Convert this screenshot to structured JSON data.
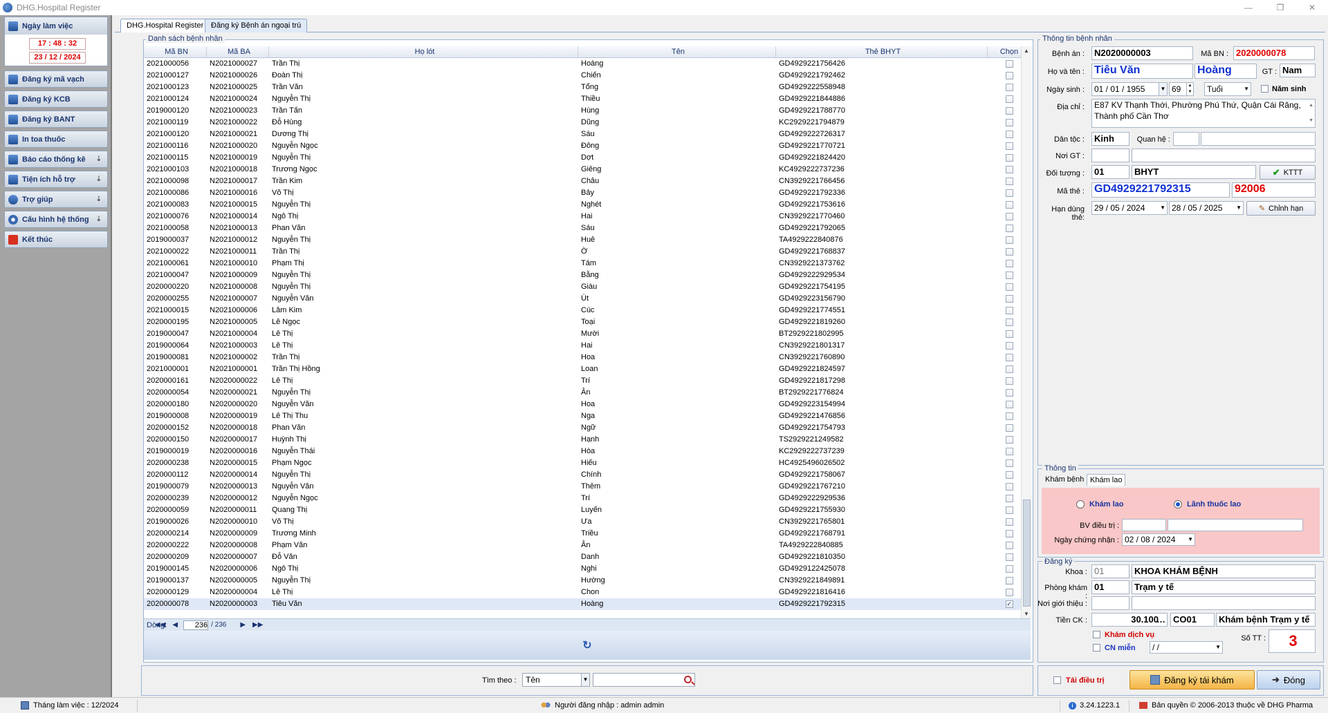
{
  "window": {
    "title": "DHG.Hospital Register"
  },
  "sidebar": {
    "clock_title": "Ngày làm việc",
    "time": "17 : 48 : 32",
    "date": "23 / 12 / 2024",
    "items": [
      {
        "label": "Đăng ký mã vạch",
        "icon": "barcode-icon",
        "chevron": false
      },
      {
        "label": "Đăng ký KCB",
        "icon": "clipboard-icon",
        "chevron": false
      },
      {
        "label": "Đăng ký BANT",
        "icon": "record-icon",
        "chevron": false
      },
      {
        "label": "In toa thuốc",
        "icon": "printer-icon",
        "chevron": false
      },
      {
        "label": "Báo cáo thống kê",
        "icon": "report-icon",
        "chevron": true
      },
      {
        "label": "Tiện ích hỗ trợ",
        "icon": "tools-icon",
        "chevron": true
      },
      {
        "label": "Trợ giúp",
        "icon": "help-icon",
        "chevron": true
      },
      {
        "label": "Cấu hình hệ thống",
        "icon": "gear-icon",
        "chevron": true
      },
      {
        "label": "Kết thúc",
        "icon": "exit-icon",
        "chevron": false
      }
    ]
  },
  "tabs": [
    {
      "label": "DHG.Hospital Register"
    },
    {
      "label": "Đăng ký Bệnh án ngoại trú"
    }
  ],
  "list": {
    "group_title": "Danh sách bệnh nhân",
    "columns": [
      "Mã BN",
      "Mã BA",
      "Họ lót",
      "Tên",
      "Thẻ BHYT",
      "Chọn"
    ],
    "rows": [
      [
        "2021000056",
        "N2021000027",
        "Trần Thị",
        "Hoàng",
        "GD4929221756426",
        false
      ],
      [
        "2021000127",
        "N2021000026",
        "Đoàn Thị",
        "Chiến",
        "GD4929221792462",
        false
      ],
      [
        "2021000123",
        "N2021000025",
        "Trần Văn",
        "Tổng",
        "GD4929222558948",
        false
      ],
      [
        "2021000124",
        "N2021000024",
        "Nguyễn Thị",
        "Thiều",
        "GD4929221844886",
        false
      ],
      [
        "2019000120",
        "N2021000023",
        "Trần Tấn",
        "Hùng",
        "GD4929221788770",
        false
      ],
      [
        "2021000119",
        "N2021000022",
        "Đỗ Hùng",
        "Dũng",
        "KC2929221794879",
        false
      ],
      [
        "2021000120",
        "N2021000021",
        "Dương Thị",
        "Sáu",
        "GD4929222726317",
        false
      ],
      [
        "2021000116",
        "N2021000020",
        "Nguyễn Ngọc",
        "Đông",
        "GD4929221770721",
        false
      ],
      [
        "2021000115",
        "N2021000019",
        "Nguyễn Thị",
        "Dợt",
        "GD4929221824420",
        false
      ],
      [
        "2021000103",
        "N2021000018",
        "Trương Ngọc",
        "Giêng",
        "KC4929222737236",
        false
      ],
      [
        "2021000098",
        "N2021000017",
        "Trần Kim",
        "Châu",
        "CN3929221766456",
        false
      ],
      [
        "2021000086",
        "N2021000016",
        "Võ Thị",
        "Bảy",
        "GD4929221792336",
        false
      ],
      [
        "2021000083",
        "N2021000015",
        "Nguyễn Thị",
        "Nghét",
        "GD4929221753616",
        false
      ],
      [
        "2021000076",
        "N2021000014",
        "Ngô Thị",
        "Hai",
        "CN3929221770460",
        false
      ],
      [
        "2021000058",
        "N2021000013",
        "Phan Văn",
        "Sáu",
        "GD4929221792065",
        false
      ],
      [
        "2019000037",
        "N2021000012",
        "Nguyễn Thị",
        "Huê",
        "TA4929222840876",
        false
      ],
      [
        "2021000022",
        "N2021000011",
        "Trần Thị",
        "Ờ",
        "GD4929221768837",
        false
      ],
      [
        "2021000061",
        "N2021000010",
        "Phạm Thị",
        "Tám",
        "CN3929221373762",
        false
      ],
      [
        "2021000047",
        "N2021000009",
        "Nguyễn Thị",
        "Bằng",
        "GD4929222929534",
        false
      ],
      [
        "2020000220",
        "N2021000008",
        "Nguyễn Thị",
        "Giàu",
        "GD4929221754195",
        false
      ],
      [
        "2020000255",
        "N2021000007",
        "Nguyễn Văn",
        "Út",
        "GD4929223156790",
        false
      ],
      [
        "2021000015",
        "N2021000006",
        "Lâm Kim",
        "Cúc",
        "GD4929221774551",
        false
      ],
      [
        "2020000195",
        "N2021000005",
        "Lê Ngọc",
        "Toại",
        "GD4929221819260",
        false
      ],
      [
        "2019000047",
        "N2021000004",
        "Lê Thị",
        "Mười",
        "BT2929221802995",
        false
      ],
      [
        "2019000064",
        "N2021000003",
        "Lê Thị",
        "Hai",
        "CN3929221801317",
        false
      ],
      [
        "2019000081",
        "N2021000002",
        "Trần Thị",
        "Hoa",
        "CN3929221760890",
        false
      ],
      [
        "2021000001",
        "N2021000001",
        "Trần Thị Hồng",
        "Loan",
        "GD4929221824597",
        false
      ],
      [
        "2020000161",
        "N2020000022",
        "Lê Thị",
        "Trí",
        "GD4929221817298",
        false
      ],
      [
        "2020000054",
        "N2020000021",
        "Nguyễn Thị",
        "Ân",
        "BT2929221776824",
        false
      ],
      [
        "2020000180",
        "N2020000020",
        "Nguyễn Văn",
        "Hoa",
        "GD4929223154994",
        false
      ],
      [
        "2019000008",
        "N2020000019",
        "Lê Thị Thu",
        "Nga",
        "GD4929221476856",
        false
      ],
      [
        "2020000152",
        "N2020000018",
        "Phan Văn",
        "Ngữ",
        "GD4929221754793",
        false
      ],
      [
        "2020000150",
        "N2020000017",
        "Huỳnh Thị",
        "Hạnh",
        "TS2929221249582",
        false
      ],
      [
        "2019000019",
        "N2020000016",
        "Nguyễn Thái",
        "Hòa",
        "KC2929222737239",
        false
      ],
      [
        "2020000238",
        "N2020000015",
        "Phạm Ngọc",
        "Hiếu",
        "HC4925496026502",
        false
      ],
      [
        "2020000112",
        "N2020000014",
        "Nguyễn Thị",
        "Chính",
        "GD4929221758067",
        false
      ],
      [
        "2019000079",
        "N2020000013",
        "Nguyễn Văn",
        "Thêm",
        "GD4929221767210",
        false
      ],
      [
        "2020000239",
        "N2020000012",
        "Nguyễn Ngọc",
        "Trí",
        "GD4929222929536",
        false
      ],
      [
        "2020000059",
        "N2020000011",
        "Quang Thị",
        "Luyến",
        "GD4929221755930",
        false
      ],
      [
        "2019000026",
        "N2020000010",
        "Võ Thị",
        "Ưa",
        "CN3929221765801",
        false
      ],
      [
        "2020000214",
        "N2020000009",
        "Trương Minh",
        "Triều",
        "GD4929221768791",
        false
      ],
      [
        "2020000222",
        "N2020000008",
        "Phạm Văn",
        "Ân",
        "TA4929222840885",
        false
      ],
      [
        "2020000209",
        "N2020000007",
        "Đỗ Văn",
        "Danh",
        "GD4929221810350",
        false
      ],
      [
        "2019000145",
        "N2020000006",
        "Ngô Thị",
        "Nghi",
        "GD4929122425078",
        false
      ],
      [
        "2019000137",
        "N2020000005",
        "Nguyễn Thị",
        "Hường",
        "CN3929221849891",
        false
      ],
      [
        "2020000129",
        "N2020000004",
        "Lê Thị",
        "Chon",
        "GD4929221816416",
        false
      ],
      [
        "2020000078",
        "N2020000003",
        "Tiêu Văn",
        "Hoàng",
        "GD4929221792315",
        true
      ]
    ],
    "nav_label": "Dòng:",
    "current_row": "236",
    "total_rows": "/ 236"
  },
  "search": {
    "label": "Tìm theo :",
    "field_value": "Tên",
    "query": ""
  },
  "patient": {
    "group_title": "Thông tin bệnh nhân",
    "benh_an_label": "Bệnh án :",
    "benh_an": "N2020000003",
    "ma_bn_label": "Mã BN :",
    "ma_bn": "2020000078",
    "ho_ten_label": "Họ và tên :",
    "ho_lot": "Tiêu Văn",
    "ten": "Hoàng",
    "gt_label": "GT :",
    "gt": "Nam",
    "ngay_sinh_label": "Ngày sinh :",
    "ngay_sinh": "01 / 01 / 1955",
    "tuoi_num": "69",
    "tuoi_unit": "Tuổi",
    "nam_sinh_label": "Năm sinh",
    "dia_chi_label": "Địa chỉ :",
    "dia_chi": "E87 KV Thạnh Thới, Phường Phú Thứ, Quận Cái Răng, Thành phố Cần Thơ",
    "dan_toc_label": "Dân tộc :",
    "dan_toc": "Kinh",
    "quan_he_label": "Quan hệ :",
    "noi_gt_label": "Nơi GT :",
    "doi_tuong_label": "Đối tượng :",
    "doi_tuong_code": "01",
    "doi_tuong": "BHYT",
    "kttt_label": "KTTT",
    "ma_the_label": "Mã thẻ :",
    "ma_the": "GD4929221792315",
    "ma_kcb": "92006",
    "han_dung_label": "Hạn dùng thẻ:",
    "han_tu": "29 / 05 / 2024",
    "han_den": "28 / 05 / 2025",
    "chinh_han_label": "Chỉnh hạn"
  },
  "thongtin": {
    "group_title": "Thông tin",
    "tabs": [
      "Khám bệnh",
      "Khám lao"
    ],
    "radio_kham_lao": "Khám lao",
    "radio_lanh_thuoc": "Lãnh thuốc lao",
    "bv_dieu_tri_label": "BV điều trị :",
    "ngay_chung_nhan_label": "Ngày chứng nhận :",
    "ngay_chung_nhan": "02 / 08 / 2024"
  },
  "dangky": {
    "group_title": "Đăng ký",
    "khoa_label": "Khoa :",
    "khoa_code": "01",
    "khoa": "KHOA KHÁM BỆNH",
    "phong_kham_label": "Phòng khám :",
    "phong_kham_code": "01",
    "phong_kham": "Trạm y tế",
    "noi_gioi_thieu_label": "Nơi giới thiệu :",
    "tien_ck_label": "Tiền CK :",
    "tien_ck": "30.100",
    "ck_code": "CO01",
    "ck_name": "Khám bệnh Trạm y tế",
    "kham_dich_vu": "Khám dịch vụ",
    "cn_mien": "CN miễn",
    "cn_mien_date": "  /   /",
    "so_tt_label": "Số TT :",
    "so_tt": "3"
  },
  "bottom": {
    "tai_dieu_tri": "Tái điều trị",
    "dang_ky_tai_kham": "Đăng ký tái khám",
    "dong": "Đóng"
  },
  "status": {
    "thang_lam_viec": "Tháng làm việc : 12/2024",
    "nguoi_dang_nhap": "Người đăng nhập : admin admin",
    "version": "3.24.1223.1",
    "copyright": "Bản quyền © 2006-2013 thuộc về DHG Pharma"
  },
  "colors": {
    "accent_red": "#e00000",
    "accent_blue": "#1030d0",
    "pink_panel": "#f9c7c7"
  }
}
